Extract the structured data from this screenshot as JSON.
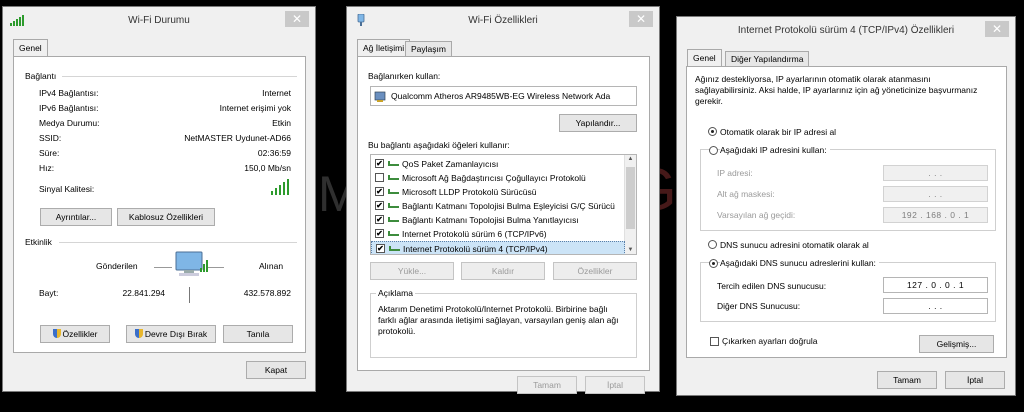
{
  "watermark": {
    "text_left": "M",
    "text_right": "Gökgöz"
  },
  "status": {
    "title": "Wi-Fi Durumu",
    "tab_general": "Genel",
    "connection_header": "Bağlantı",
    "rows": [
      {
        "label": "IPv4 Bağlantısı:",
        "value": "Internet"
      },
      {
        "label": "IPv6 Bağlantısı:",
        "value": "Internet erişimi yok"
      },
      {
        "label": "Medya Durumu:",
        "value": "Etkin"
      },
      {
        "label": "SSID:",
        "value": "NetMASTER Uydunet-AD66"
      },
      {
        "label": "Süre:",
        "value": "02:36:59"
      },
      {
        "label": "Hız:",
        "value": "150,0 Mb/sn"
      }
    ],
    "signal_label": "Sinyal Kalitesi:",
    "btn_details": "Ayrıntılar...",
    "btn_wireless": "Kablosuz Özellikleri",
    "activity_header": "Etkinlik",
    "sent_label": "Gönderilen",
    "received_label": "Alınan",
    "bytes_label": "Bayt:",
    "bytes_sent": "22.841.294",
    "bytes_received": "432.578.892",
    "btn_properties": "Özellikler",
    "btn_disable": "Devre Dışı Bırak",
    "btn_diagnose": "Tanıla",
    "btn_close": "Kapat"
  },
  "props": {
    "title": "Wi-Fi Özellikleri",
    "tab_network": "Ağ İletişimi",
    "tab_sharing": "Paylaşım",
    "connect_using": "Bağlanırken kullan:",
    "adapter": "Qualcomm Atheros AR9485WB-EG Wireless Network Ada",
    "btn_configure": "Yapılandır...",
    "items_label": "Bu bağlantı aşağıdaki öğeleri kullanır:",
    "items": [
      {
        "label": "QoS Paket Zamanlayıcısı",
        "checked": "✔"
      },
      {
        "label": "Microsoft Ağ Bağdaştırıcısı Çoğullayıcı Protokolü",
        "checked": ""
      },
      {
        "label": "Microsoft LLDP Protokolü Sürücüsü",
        "checked": "✔"
      },
      {
        "label": "Bağlantı Katmanı Topolojisi Bulma Eşleyicisi G/Ç Sürücü",
        "checked": "✔"
      },
      {
        "label": "Bağlantı Katmanı Topolojisi Bulma Yanıtlayıcısı",
        "checked": "✔"
      },
      {
        "label": "Internet Protokolü sürüm 6 (TCP/IPv6)",
        "checked": "✔"
      },
      {
        "label": "Internet Protokolü sürüm 4 (TCP/IPv4)",
        "checked": "✔"
      }
    ],
    "btn_install": "Yükle...",
    "btn_remove": "Kaldır",
    "btn_props": "Özellikler",
    "desc_header": "Açıklama",
    "desc_text_1": "Aktarım Denetimi Protokolü/Internet Protokolü. Birbirine bağlı",
    "desc_text_2": "farklı ağlar arasında iletişimi sağlayan, varsayılan geniş alan ağı",
    "desc_text_3": "protokolü.",
    "btn_ok": "Tamam",
    "btn_cancel": "İptal"
  },
  "ipv4": {
    "title": "Internet Protokolü sürüm 4 (TCP/IPv4) Özellikleri",
    "tab_general": "Genel",
    "tab_alt": "Diğer Yapılandırma",
    "intro_1": "Ağınız destekliyorsa, IP ayarlarının otomatik olarak atanmasını",
    "intro_2": "sağlayabilirsiniz. Aksi halde, IP ayarlarınız için ağ yöneticinize başvurmanız",
    "intro_3": "gerekir.",
    "radio_auto_ip": "Otomatik olarak bir IP adresi al",
    "radio_manual_ip": "Aşağıdaki IP adresini kullan:",
    "ip_label": "IP adresi:",
    "mask_label": "Alt ağ maskesi:",
    "gateway_label": "Varsayılan ağ geçidi:",
    "ip_value": ". . .",
    "mask_value": ". . .",
    "gateway_value": "192 . 168 . 0 . 1",
    "radio_auto_dns": "DNS sunucu adresini otomatik olarak al",
    "radio_manual_dns": "Aşağıdaki DNS sunucu adreslerini kullan:",
    "pref_dns_label": "Tercih edilen DNS sunucusu:",
    "alt_dns_label": "Diğer DNS Sunucusu:",
    "pref_dns_value": "127 . 0 . 0 . 1",
    "alt_dns_value": ". . .",
    "validate_label": "Çıkarken ayarları doğrula",
    "btn_advanced": "Gelişmiş...",
    "btn_ok": "Tamam",
    "btn_cancel": "İptal"
  }
}
